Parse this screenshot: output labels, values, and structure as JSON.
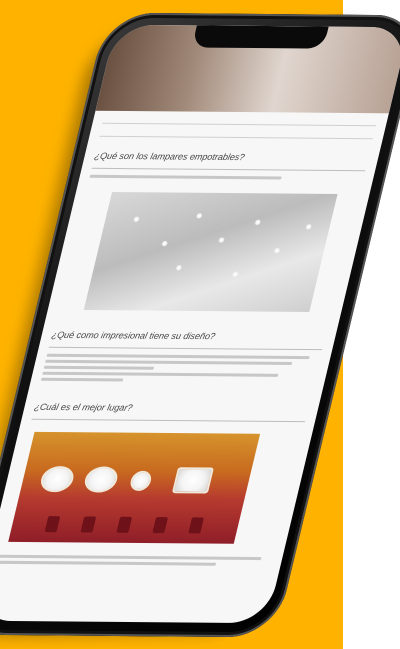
{
  "screen": {
    "section_headings": [
      "¿Qué son los lampares empotrables?",
      "¿Qué como impresional tiene su diseño?",
      "¿Cuál es el mejor lugar?"
    ]
  },
  "colors": {
    "background_accent": "#ffb300",
    "phone_body": "#111111"
  },
  "icons": [
    "phone-notch-icon"
  ]
}
